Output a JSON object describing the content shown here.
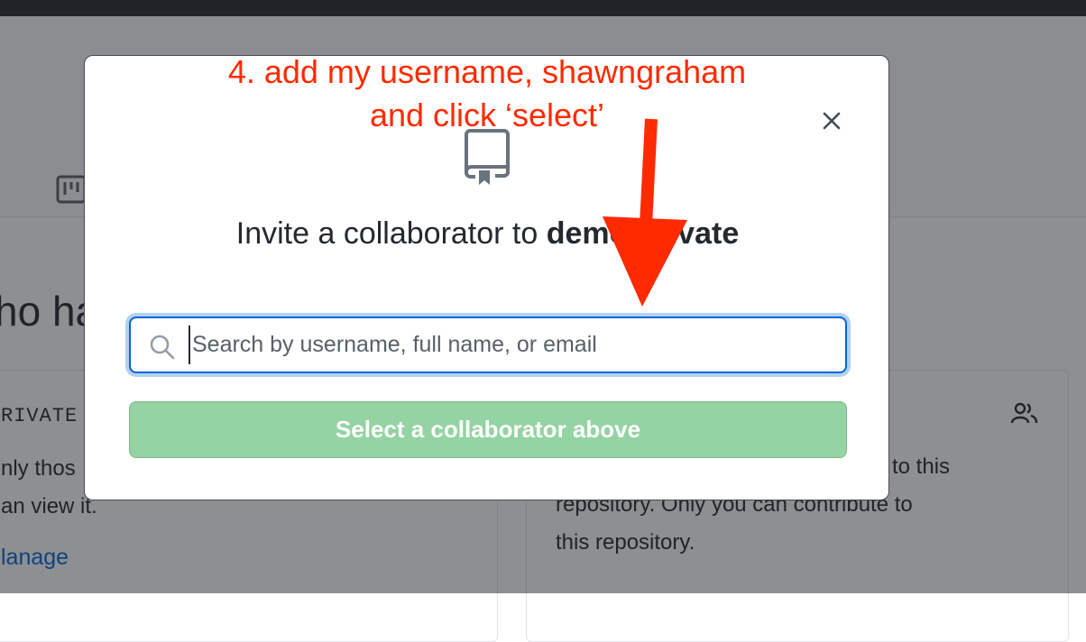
{
  "background": {
    "heading_fragment": "ho ha",
    "left_card": {
      "visibility_label": "RIVATE",
      "text_lines": [
        "nly thos",
        "an view it."
      ],
      "manage_link": "lanage"
    },
    "right_card": {
      "text_lines": [
        "to this",
        "repository. Only you can contribute to",
        "this repository."
      ]
    }
  },
  "modal": {
    "title_prefix": "Invite a collaborator to ",
    "repo_name": "demo-private",
    "search": {
      "placeholder": "Search by username, full name, or email",
      "value": ""
    },
    "select_button_label": "Select a collaborator above"
  },
  "annotation": {
    "lines": [
      "4. add my username, shawngraham",
      "and click ‘select’"
    ]
  },
  "icons": {
    "close": "close-icon",
    "repo": "repo-icon",
    "search": "search-icon",
    "projects": "project-icon",
    "people": "people-icon"
  },
  "colors": {
    "annotation": "#ff2a00",
    "link": "#0366d6",
    "button_disabled": "#94d3a2",
    "focus_border": "#0366d6"
  }
}
